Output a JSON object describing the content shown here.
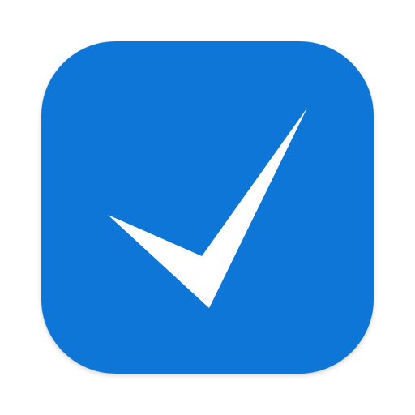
{
  "icon": {
    "name": "checkmark-app-icon",
    "background_color": "#0D76D6",
    "glyph_color": "#FFFFFF",
    "glyph": "checkmark-icon"
  }
}
